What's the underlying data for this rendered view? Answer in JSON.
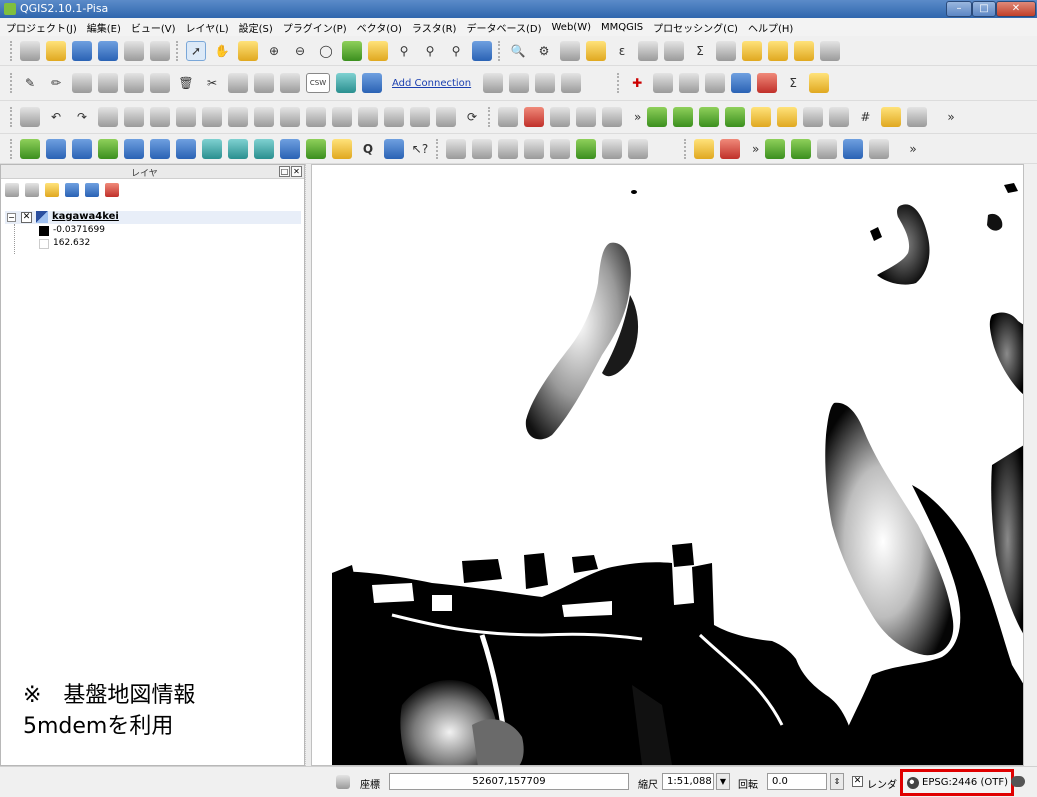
{
  "window": {
    "title": "QGIS2.10.1-Pisa"
  },
  "menu": {
    "items": [
      "プロジェクト(J)",
      "編集(E)",
      "ビュー(V)",
      "レイヤ(L)",
      "設定(S)",
      "プラグイン(P)",
      "ベクタ(O)",
      "ラスタ(R)",
      "データベース(D)",
      "Web(W)",
      "MMQGIS",
      "プロセッシング(C)",
      "ヘルプ(H)"
    ]
  },
  "toolbar": {
    "add_connection": "Add Connection",
    "csw": "CSW",
    "more": "»"
  },
  "layers_panel": {
    "title": "レイヤ",
    "layer": {
      "name": "kagawa4kei",
      "legend_min": "-0.0371699",
      "legend_max": "162.632"
    },
    "note_line1": "※　基盤地図情報",
    "note_line2": "5mdemを利用"
  },
  "statusbar": {
    "coord_label": "座標",
    "coord_value": "52607,157709",
    "scale_label": "縮尺",
    "scale_value": "1:51,088",
    "rotation_label": "回転",
    "rotation_value": "0.0",
    "render_label": "レンダ",
    "crs": "EPSG:2446 (OTF)"
  },
  "colors": {
    "title_bar": "#2f66ad",
    "crs_highlight": "#e00000",
    "raster_low": "#000000",
    "raster_high": "#ffffff"
  }
}
